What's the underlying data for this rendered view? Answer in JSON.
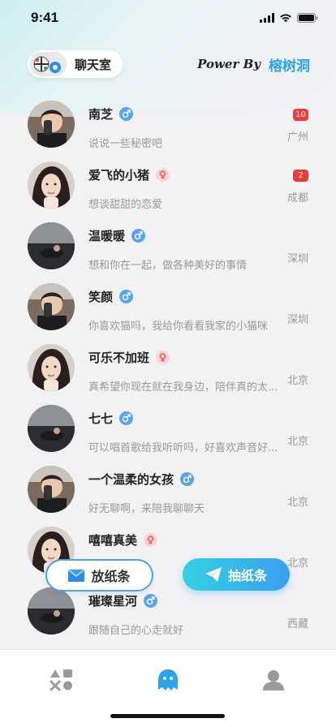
{
  "status": {
    "time": "9:41",
    "icons": [
      "signal-icon",
      "wifi-icon",
      "battery-icon"
    ]
  },
  "header": {
    "chatroom_label": "聊天室",
    "power_by": "Power By",
    "brand": "榕树洞"
  },
  "colors": {
    "accent": "#2aa3e8",
    "badge": "#ee3b3b",
    "male": "#5aa3f2",
    "female": "#ffd4d6"
  },
  "chats": [
    {
      "name": "南芝",
      "gender": "male",
      "message": "说说一些秘密吧",
      "city": "广州",
      "unread": "10",
      "avatar": "boy"
    },
    {
      "name": "爱飞的小猪",
      "gender": "female",
      "message": "想谈甜甜的恋爱",
      "city": "成都",
      "unread": "2",
      "avatar": "girl"
    },
    {
      "name": "温暖暖",
      "gender": "male",
      "message": "想和你在一起，做各种美好的事情",
      "city": "深圳",
      "unread": "",
      "avatar": "dark"
    },
    {
      "name": "笑颜",
      "gender": "male",
      "message": "你喜欢猫吗，我给你看看我家的小猫咪",
      "city": "深圳",
      "unread": "",
      "avatar": "boy"
    },
    {
      "name": "可乐不加班",
      "gender": "female",
      "message": "真希望你现在就在我身边，陪伴真的太...",
      "city": "北京",
      "unread": "",
      "avatar": "girl"
    },
    {
      "name": "七七",
      "gender": "male",
      "message": "可以唱首歌给我听听吗，好喜欢声音好...",
      "city": "北京",
      "unread": "",
      "avatar": "dark"
    },
    {
      "name": "一个温柔的女孩",
      "gender": "male",
      "message": "好无聊啊，来陪我聊聊天",
      "city": "北京",
      "unread": "",
      "avatar": "boy"
    },
    {
      "name": "嘻嘻真美",
      "gender": "female",
      "message": "",
      "city": "北京",
      "unread": "",
      "avatar": "girl"
    },
    {
      "name": "璀璨星河",
      "gender": "male",
      "message": "跟随自己的心走就好",
      "city": "西藏",
      "unread": "",
      "avatar": "dark"
    }
  ],
  "actions": {
    "release_label": "放纸条",
    "draw_label": "抽纸条"
  },
  "tabs": [
    "apps-icon",
    "ghost-chat-icon",
    "profile-icon"
  ]
}
